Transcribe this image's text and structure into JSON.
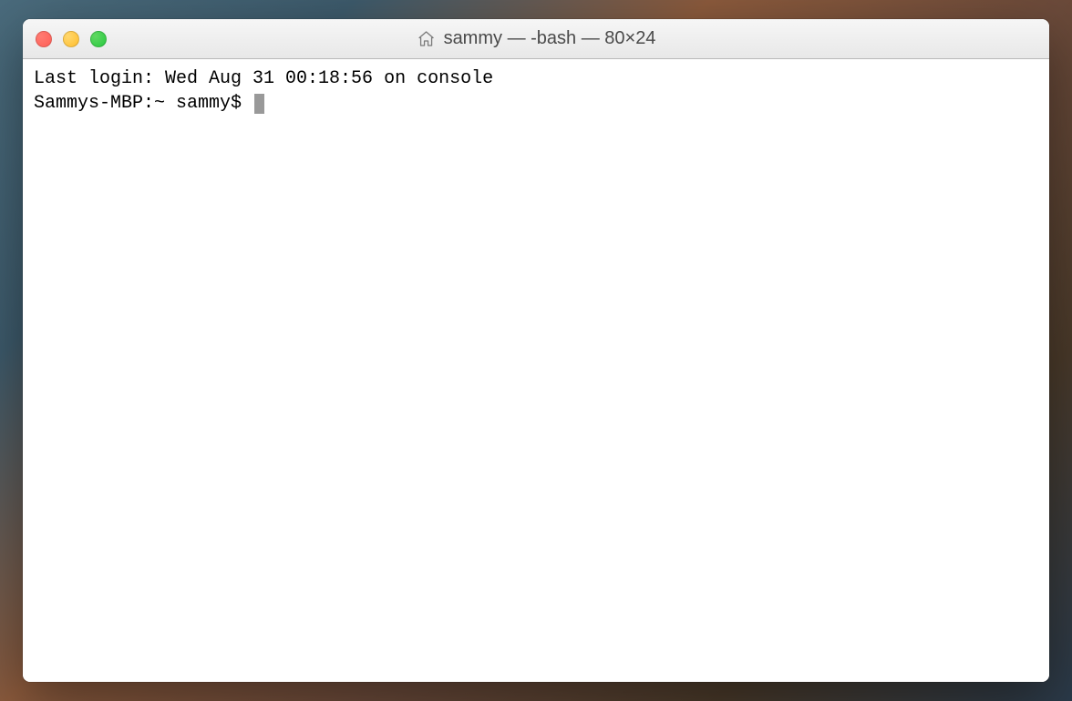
{
  "window": {
    "title": "sammy — -bash — 80×24"
  },
  "terminal": {
    "last_login_line": "Last login: Wed Aug 31 00:18:56 on console",
    "prompt": "Sammys-MBP:~ sammy$ "
  }
}
